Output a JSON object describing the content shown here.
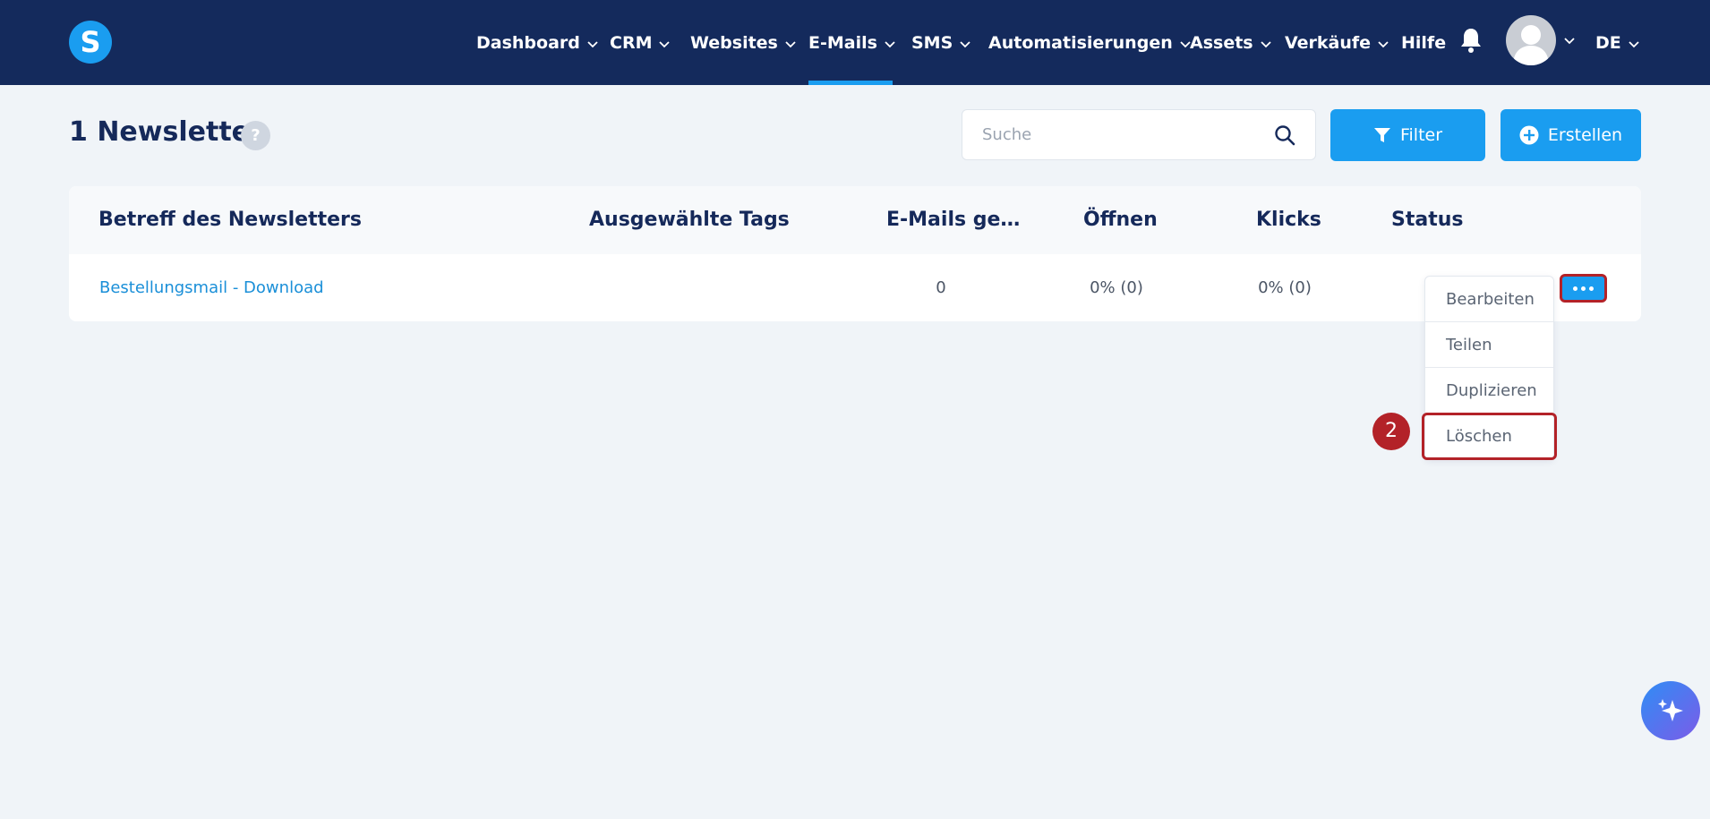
{
  "header": {
    "logo_letter": "S",
    "nav": [
      {
        "label": "Dashboard",
        "has_dropdown": true
      },
      {
        "label": "CRM",
        "has_dropdown": true
      },
      {
        "label": "Websites",
        "has_dropdown": true
      },
      {
        "label": "E-Mails",
        "has_dropdown": true,
        "active": true
      },
      {
        "label": "SMS",
        "has_dropdown": true
      },
      {
        "label": "Automatisierungen",
        "has_dropdown": true
      },
      {
        "label": "Assets",
        "has_dropdown": true
      },
      {
        "label": "Verkäufe",
        "has_dropdown": true
      },
      {
        "label": "Hilfe",
        "has_dropdown": false
      }
    ],
    "language": "DE",
    "icons": {
      "notifications": "bell-icon",
      "profile": "avatar"
    }
  },
  "page": {
    "title": "1 Newsletter",
    "help_symbol": "?",
    "search_placeholder": "Suche",
    "filter_label": "Filter",
    "create_label": "Erstellen"
  },
  "table": {
    "columns": [
      "Betreff des Newsletters",
      "Ausgewählte Tags",
      "E-Mails ge...",
      "Öffnen",
      "Klicks",
      "Status"
    ],
    "rows": [
      {
        "subject": "Bestellungsmail - Download",
        "tags": "",
        "emails_sent": "0",
        "opens": "0% (0)",
        "clicks": "0% (0)",
        "status": ""
      }
    ]
  },
  "row_menu": {
    "items": [
      "Bearbeiten",
      "Teilen",
      "Duplizieren",
      "Löschen"
    ],
    "highlighted_item": "Löschen"
  },
  "annotation": {
    "step_number": "2",
    "color": "#b32228"
  },
  "colors": {
    "navbar": "#142a5c",
    "accent": "#1a9df0",
    "background": "#f0f4f8",
    "link": "#1a8fd8"
  }
}
